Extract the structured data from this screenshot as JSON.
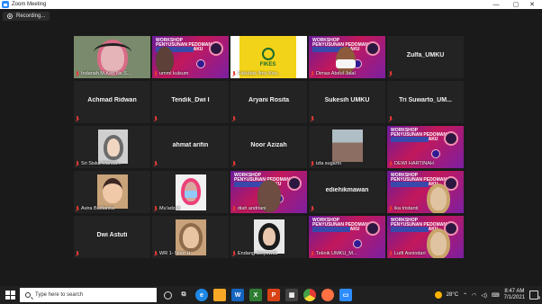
{
  "window": {
    "title": "Zoom Meeting",
    "minimize": "—",
    "maximize": "▢",
    "close": "✕"
  },
  "recording": {
    "label": "Recording..."
  },
  "participants": [
    {
      "name": "Indanah M.Kep.Ns.S...",
      "kind": "video-woman-headset",
      "active": true
    },
    {
      "name": "ummi kulsum",
      "kind": "video-slide-woman"
    },
    {
      "name": "Fakultas  Ilmu Kes...",
      "kind": "video-logo",
      "logo_text": "FIKES"
    },
    {
      "name": "Dimas Abdul Jalal",
      "kind": "video-slide-man"
    },
    {
      "name": "Zulfa_UMKU",
      "kind": "name-only"
    },
    {
      "name": "Achmad Ridwan",
      "kind": "name-only"
    },
    {
      "name": "Tendik_Dwi I",
      "kind": "name-only"
    },
    {
      "name": "Aryani Rosita",
      "kind": "name-only"
    },
    {
      "name": "Sukesih UMKU",
      "kind": "name-only"
    },
    {
      "name": "Tri  Suwarto_UM...",
      "kind": "name-only"
    },
    {
      "name": "Sri Siska Mardia...",
      "kind": "photo-hijab"
    },
    {
      "name": "ahmat arifin",
      "kind": "name-only"
    },
    {
      "name": "Noor Azizah",
      "kind": "name-only"
    },
    {
      "name": "izla sugarto",
      "kind": "photo-building"
    },
    {
      "name": "DEWI HARTINAH",
      "kind": "video-slide"
    },
    {
      "name": "Avira Budianita",
      "kind": "photo-girl"
    },
    {
      "name": "Mu'adzah",
      "kind": "video-mask"
    },
    {
      "name": "diah andriani",
      "kind": "video-slide-face"
    },
    {
      "name": "ediehikmawan",
      "kind": "name-only"
    },
    {
      "name": "ika tristanti",
      "kind": "video-slide-hijab"
    },
    {
      "name": "Dwi Astuti",
      "kind": "name-only"
    },
    {
      "name": "WR 1- Noor H",
      "kind": "video-woman-glasses"
    },
    {
      "name": "Endang Setyowati",
      "kind": "photo-hijab-dark"
    },
    {
      "name": "Teknik UMKU_M...",
      "kind": "video-slide"
    },
    {
      "name": "Lutfi Asnindari",
      "kind": "video-slide-hijab"
    }
  ],
  "slide_text": {
    "line1": "WORKSHOP",
    "line2": "PENYUSUNAN PEDOMAN",
    "line3": "OPERASIONAL BAKU"
  },
  "taskbar": {
    "search_placeholder": "Type here to search",
    "apps": [
      "task-view",
      "widgets",
      "edge",
      "file-explorer",
      "word",
      "excel",
      "powerpoint",
      "store",
      "chrome",
      "firefox",
      "zoom"
    ],
    "temperature": "28°C",
    "time": "8:47 AM",
    "date": "7/1/2021",
    "notification_count": "4"
  }
}
